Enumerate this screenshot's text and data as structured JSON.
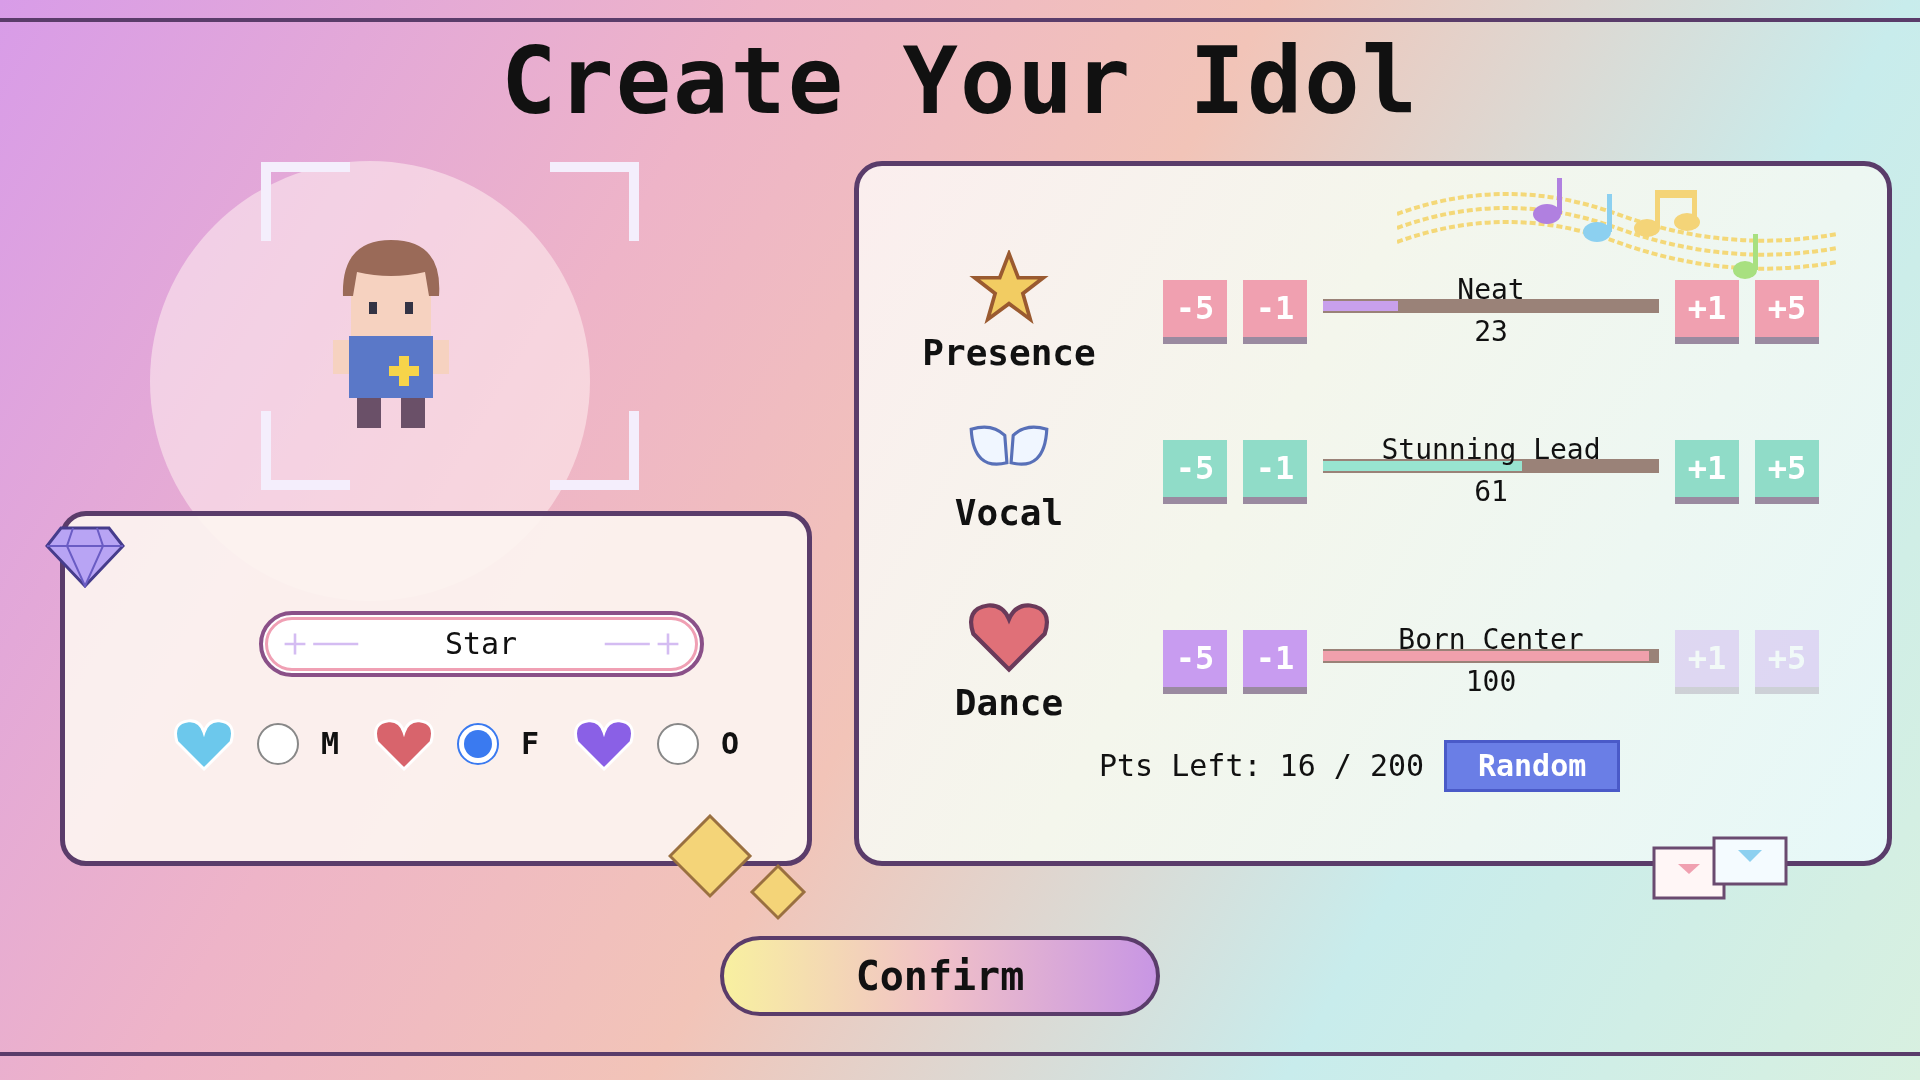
{
  "title": "Create Your Idol",
  "name_field": {
    "value": "Star"
  },
  "genders": [
    {
      "label": "M",
      "color": "#6cc8ec",
      "selected": false
    },
    {
      "label": "F",
      "color": "#d8646c",
      "selected": true
    },
    {
      "label": "O",
      "color": "#8a60e6",
      "selected": false
    }
  ],
  "stats": [
    {
      "name": "Presence",
      "rank": "Neat",
      "value": "23",
      "bar": {
        "level": 0.23,
        "color": "#c8a0ec"
      },
      "color": "#f0a0b0",
      "minus": [
        {
          "label": "-5",
          "disabled": false
        },
        {
          "label": "-1",
          "disabled": false
        }
      ],
      "plus": [
        {
          "label": "+1",
          "disabled": false
        },
        {
          "label": "+5",
          "disabled": false
        }
      ]
    },
    {
      "name": "Vocal",
      "rank": "Stunning Lead",
      "value": "61",
      "bar": {
        "level": 0.61,
        "color": "#98e4d0"
      },
      "color": "#90dcc8",
      "minus": [
        {
          "label": "-5",
          "disabled": false
        },
        {
          "label": "-1",
          "disabled": false
        }
      ],
      "plus": [
        {
          "label": "+1",
          "disabled": false
        },
        {
          "label": "+5",
          "disabled": false
        }
      ]
    },
    {
      "name": "Dance",
      "rank": "Born Center",
      "value": "100",
      "bar": {
        "level": 1.0,
        "color": "#f0a0ac"
      },
      "color": "#c89cf0",
      "minus": [
        {
          "label": "-5",
          "disabled": false
        },
        {
          "label": "-1",
          "disabled": false
        }
      ],
      "plus": [
        {
          "label": "+1",
          "disabled": true
        },
        {
          "label": "+5",
          "disabled": true
        }
      ]
    }
  ],
  "points": {
    "label": "Pts Left: 16 / 200"
  },
  "random_button": "Random",
  "confirm_button": "Confirm"
}
